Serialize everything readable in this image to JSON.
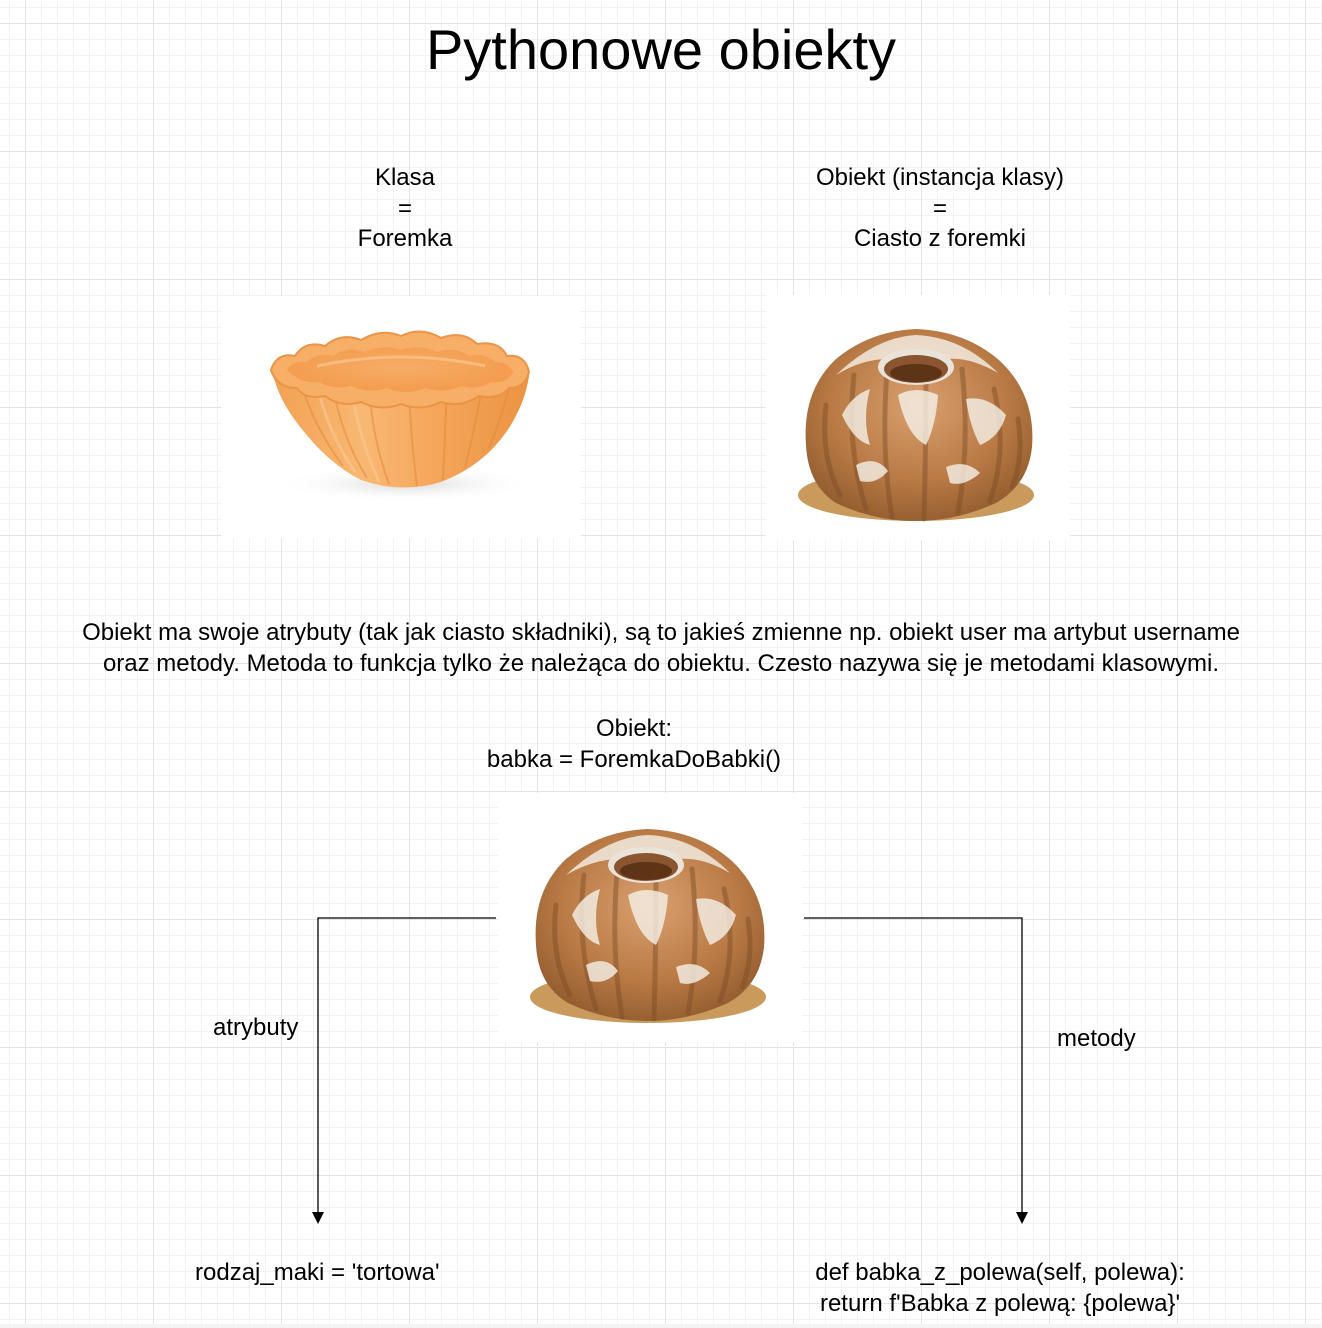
{
  "title": "Pythonowe obiekty",
  "class_side": {
    "line1": "Klasa",
    "equals": "=",
    "line2": "Foremka"
  },
  "object_side": {
    "line1": "Obiekt (instancja klasy)",
    "equals": "=",
    "line2": "Ciasto z foremki"
  },
  "description": {
    "line1": "Obiekt ma swoje atrybuty (tak jak ciasto składniki), są to jakieś zmienne np. obiekt user ma artybut username",
    "line2": "oraz metody. Metoda to funkcja tylko że należąca do obiektu. Czesto nazywa się je metodami klasowymi."
  },
  "object_caption": {
    "line1": "Obiekt:",
    "line2": "babka = ForemkaDoBabki()"
  },
  "labels": {
    "attributes": "atrybuty",
    "methods": "metody"
  },
  "attribute_example": "rodzaj_maki = 'tortowa'",
  "method_example": {
    "line1": "def babka_z_polewa(self, polewa):",
    "line2": "return f'Babka z polewą: {polewa}'"
  },
  "colors": {
    "mold_orange": "#f4a35a",
    "cake_brown": "#b8743f",
    "sugar_white": "#f4efe6",
    "connector": "#000000"
  }
}
